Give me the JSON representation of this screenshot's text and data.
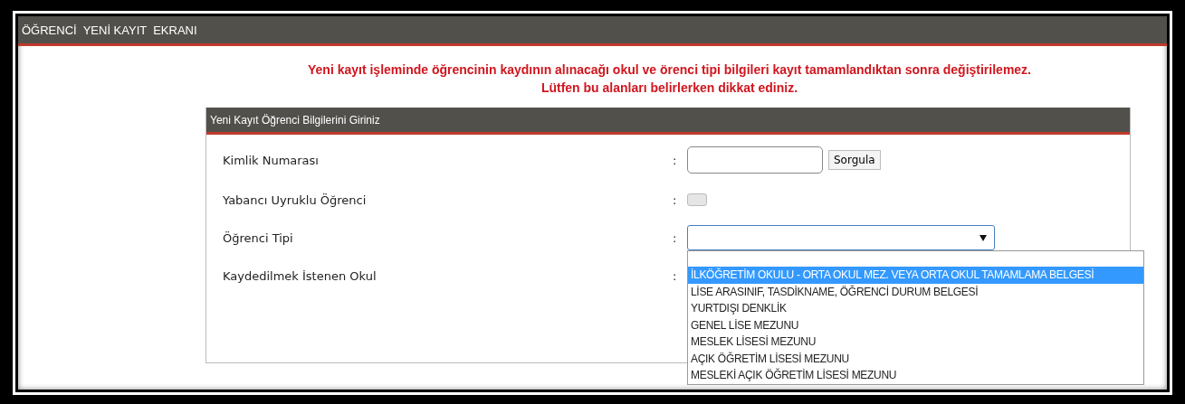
{
  "window": {
    "title": "ÖĞRENCİ  YENİ KAYIT  EKRANI"
  },
  "warning": [
    "Yeni kayıt işleminde öğrencinin kaydının alınacağı okul ve örenci tipi bilgileri kayıt tamamlandıktan sonra değiştirilemez.",
    "Lütfen bu alanları belirlerken dikkat ediniz."
  ],
  "panel": {
    "title": "Yeni Kayıt Öğrenci Bilgilerini Giriniz",
    "rows": [
      {
        "kind": "input",
        "label": "Kimlik Numarası",
        "colon": ":",
        "button": "Sorgula"
      },
      {
        "kind": "checkbox",
        "label": "Yabancı Uyruklu Öğrenci",
        "colon": ":",
        "checked": false
      },
      {
        "kind": "select",
        "label": "Öğrenci Tipi",
        "colon": ":",
        "expanded": true,
        "options": [
          {
            "label": "İLKÖĞRETİM OKULU - ORTA OKUL MEZ. VEYA ORTA OKUL TAMAMLAMA BELGESİ",
            "selected": true
          },
          {
            "label": "LİSE ARASINIF, TASDİKNAME, ÖĞRENCİ DURUM BELGESİ",
            "selected": false
          },
          {
            "label": "YURTDIŞI DENKLİK",
            "selected": false
          },
          {
            "label": "GENEL LİSE MEZUNU",
            "selected": false
          },
          {
            "label": "MESLEK LİSESİ MEZUNU",
            "selected": false
          },
          {
            "label": "AÇIK ÖĞRETİM LİSESİ MEZUNU",
            "selected": false
          },
          {
            "label": "MESLEKİ AÇIK ÖĞRETİM LİSESİ MEZUNU",
            "selected": false
          }
        ]
      },
      {
        "kind": "blank",
        "label": "Kaydedilmek İstenen Okul",
        "colon": ":"
      }
    ]
  }
}
